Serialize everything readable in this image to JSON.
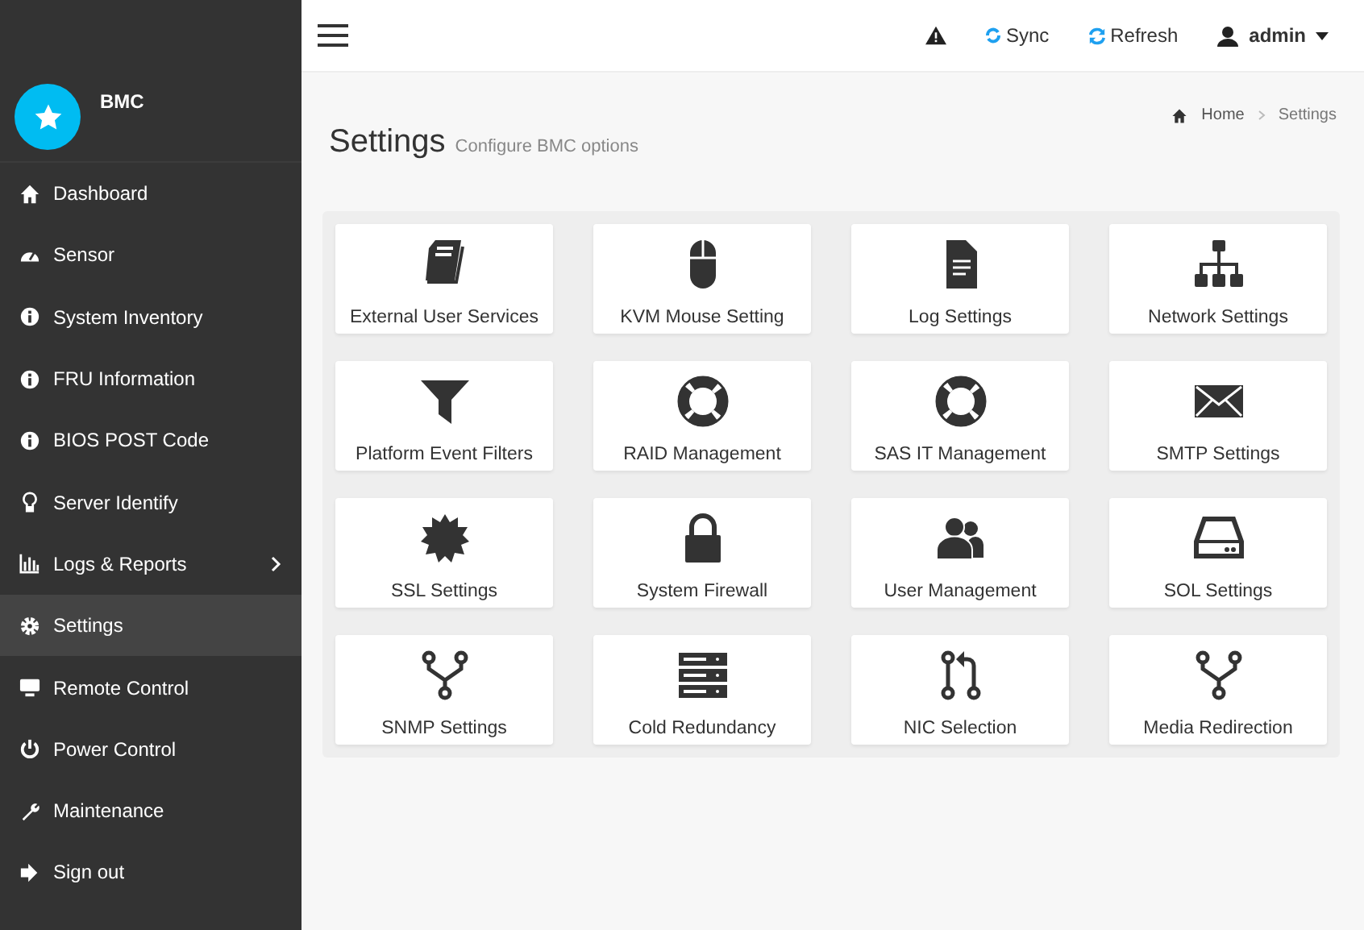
{
  "brand": {
    "name": "BMC"
  },
  "sidebar": {
    "items": [
      {
        "label": "Dashboard",
        "selected": false
      },
      {
        "label": "Sensor",
        "selected": false
      },
      {
        "label": "System Inventory",
        "selected": false
      },
      {
        "label": "FRU Information",
        "selected": false
      },
      {
        "label": "BIOS POST Code",
        "selected": false
      },
      {
        "label": "Server Identify",
        "selected": false
      },
      {
        "label": "Logs & Reports",
        "selected": false,
        "submenu": true
      },
      {
        "label": "Settings",
        "selected": true
      },
      {
        "label": "Remote Control",
        "selected": false
      },
      {
        "label": "Power Control",
        "selected": false
      },
      {
        "label": "Maintenance",
        "selected": false
      },
      {
        "label": "Sign out",
        "selected": false
      }
    ]
  },
  "topbar": {
    "sync": "Sync",
    "refresh": "Refresh",
    "user": "admin"
  },
  "page": {
    "title": "Settings",
    "subtitle": "Configure BMC options"
  },
  "breadcrumb": [
    "Home",
    "Settings"
  ],
  "tiles": [
    {
      "label": "External User Services"
    },
    {
      "label": "KVM Mouse Setting"
    },
    {
      "label": "Log Settings"
    },
    {
      "label": "Network Settings"
    },
    {
      "label": "Platform Event Filters"
    },
    {
      "label": "RAID Management"
    },
    {
      "label": "SAS IT Management"
    },
    {
      "label": "SMTP Settings"
    },
    {
      "label": "SSL Settings"
    },
    {
      "label": "System Firewall"
    },
    {
      "label": "User Management"
    },
    {
      "label": "SOL Settings"
    },
    {
      "label": "SNMP Settings"
    },
    {
      "label": "Cold Redundancy"
    },
    {
      "label": "NIC Selection"
    },
    {
      "label": "Media Redirection"
    }
  ]
}
